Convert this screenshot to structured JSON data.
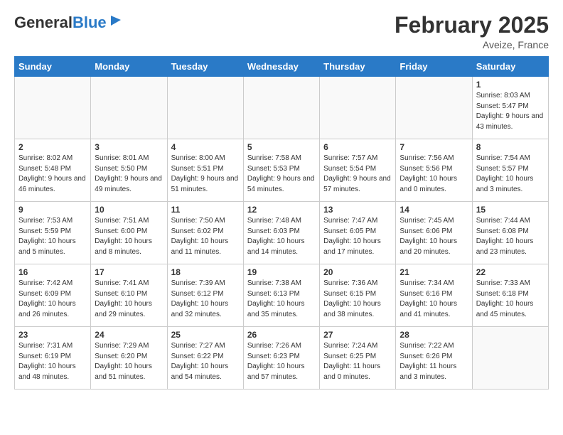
{
  "header": {
    "logo_general": "General",
    "logo_blue": "Blue",
    "month_title": "February 2025",
    "location": "Aveize, France"
  },
  "weekdays": [
    "Sunday",
    "Monday",
    "Tuesday",
    "Wednesday",
    "Thursday",
    "Friday",
    "Saturday"
  ],
  "weeks": [
    [
      {
        "day": "",
        "info": ""
      },
      {
        "day": "",
        "info": ""
      },
      {
        "day": "",
        "info": ""
      },
      {
        "day": "",
        "info": ""
      },
      {
        "day": "",
        "info": ""
      },
      {
        "day": "",
        "info": ""
      },
      {
        "day": "1",
        "info": "Sunrise: 8:03 AM\nSunset: 5:47 PM\nDaylight: 9 hours and 43 minutes."
      }
    ],
    [
      {
        "day": "2",
        "info": "Sunrise: 8:02 AM\nSunset: 5:48 PM\nDaylight: 9 hours and 46 minutes."
      },
      {
        "day": "3",
        "info": "Sunrise: 8:01 AM\nSunset: 5:50 PM\nDaylight: 9 hours and 49 minutes."
      },
      {
        "day": "4",
        "info": "Sunrise: 8:00 AM\nSunset: 5:51 PM\nDaylight: 9 hours and 51 minutes."
      },
      {
        "day": "5",
        "info": "Sunrise: 7:58 AM\nSunset: 5:53 PM\nDaylight: 9 hours and 54 minutes."
      },
      {
        "day": "6",
        "info": "Sunrise: 7:57 AM\nSunset: 5:54 PM\nDaylight: 9 hours and 57 minutes."
      },
      {
        "day": "7",
        "info": "Sunrise: 7:56 AM\nSunset: 5:56 PM\nDaylight: 10 hours and 0 minutes."
      },
      {
        "day": "8",
        "info": "Sunrise: 7:54 AM\nSunset: 5:57 PM\nDaylight: 10 hours and 3 minutes."
      }
    ],
    [
      {
        "day": "9",
        "info": "Sunrise: 7:53 AM\nSunset: 5:59 PM\nDaylight: 10 hours and 5 minutes."
      },
      {
        "day": "10",
        "info": "Sunrise: 7:51 AM\nSunset: 6:00 PM\nDaylight: 10 hours and 8 minutes."
      },
      {
        "day": "11",
        "info": "Sunrise: 7:50 AM\nSunset: 6:02 PM\nDaylight: 10 hours and 11 minutes."
      },
      {
        "day": "12",
        "info": "Sunrise: 7:48 AM\nSunset: 6:03 PM\nDaylight: 10 hours and 14 minutes."
      },
      {
        "day": "13",
        "info": "Sunrise: 7:47 AM\nSunset: 6:05 PM\nDaylight: 10 hours and 17 minutes."
      },
      {
        "day": "14",
        "info": "Sunrise: 7:45 AM\nSunset: 6:06 PM\nDaylight: 10 hours and 20 minutes."
      },
      {
        "day": "15",
        "info": "Sunrise: 7:44 AM\nSunset: 6:08 PM\nDaylight: 10 hours and 23 minutes."
      }
    ],
    [
      {
        "day": "16",
        "info": "Sunrise: 7:42 AM\nSunset: 6:09 PM\nDaylight: 10 hours and 26 minutes."
      },
      {
        "day": "17",
        "info": "Sunrise: 7:41 AM\nSunset: 6:10 PM\nDaylight: 10 hours and 29 minutes."
      },
      {
        "day": "18",
        "info": "Sunrise: 7:39 AM\nSunset: 6:12 PM\nDaylight: 10 hours and 32 minutes."
      },
      {
        "day": "19",
        "info": "Sunrise: 7:38 AM\nSunset: 6:13 PM\nDaylight: 10 hours and 35 minutes."
      },
      {
        "day": "20",
        "info": "Sunrise: 7:36 AM\nSunset: 6:15 PM\nDaylight: 10 hours and 38 minutes."
      },
      {
        "day": "21",
        "info": "Sunrise: 7:34 AM\nSunset: 6:16 PM\nDaylight: 10 hours and 41 minutes."
      },
      {
        "day": "22",
        "info": "Sunrise: 7:33 AM\nSunset: 6:18 PM\nDaylight: 10 hours and 45 minutes."
      }
    ],
    [
      {
        "day": "23",
        "info": "Sunrise: 7:31 AM\nSunset: 6:19 PM\nDaylight: 10 hours and 48 minutes."
      },
      {
        "day": "24",
        "info": "Sunrise: 7:29 AM\nSunset: 6:20 PM\nDaylight: 10 hours and 51 minutes."
      },
      {
        "day": "25",
        "info": "Sunrise: 7:27 AM\nSunset: 6:22 PM\nDaylight: 10 hours and 54 minutes."
      },
      {
        "day": "26",
        "info": "Sunrise: 7:26 AM\nSunset: 6:23 PM\nDaylight: 10 hours and 57 minutes."
      },
      {
        "day": "27",
        "info": "Sunrise: 7:24 AM\nSunset: 6:25 PM\nDaylight: 11 hours and 0 minutes."
      },
      {
        "day": "28",
        "info": "Sunrise: 7:22 AM\nSunset: 6:26 PM\nDaylight: 11 hours and 3 minutes."
      },
      {
        "day": "",
        "info": ""
      }
    ]
  ]
}
